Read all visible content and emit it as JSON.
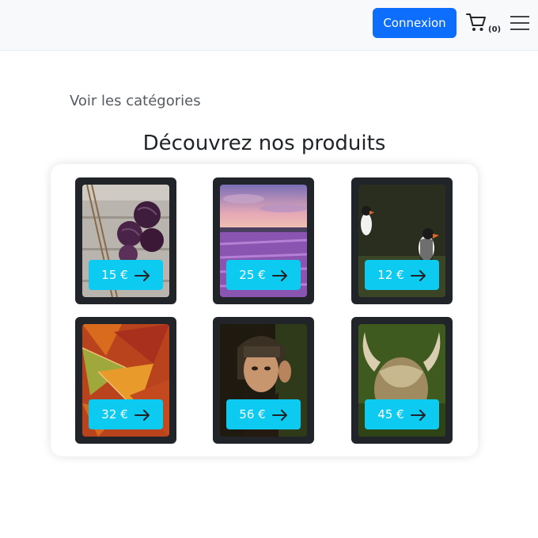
{
  "header": {
    "login_label": "Connexion",
    "cart_count": "(0)"
  },
  "main": {
    "categories_link": "Voir les catégories",
    "title": "Découvrez nos produits"
  },
  "products": [
    {
      "price": "15 €",
      "image": "yarn-balls"
    },
    {
      "price": "25 €",
      "image": "lavender-field"
    },
    {
      "price": "12 €",
      "image": "puffins"
    },
    {
      "price": "32 €",
      "image": "autumn-leaves"
    },
    {
      "price": "56 €",
      "image": "portrait-woman"
    },
    {
      "price": "45 €",
      "image": "highland-cow"
    }
  ],
  "colors": {
    "primary": "#0d6efd",
    "info": "#0dcaf0",
    "card_dark": "#212529"
  }
}
